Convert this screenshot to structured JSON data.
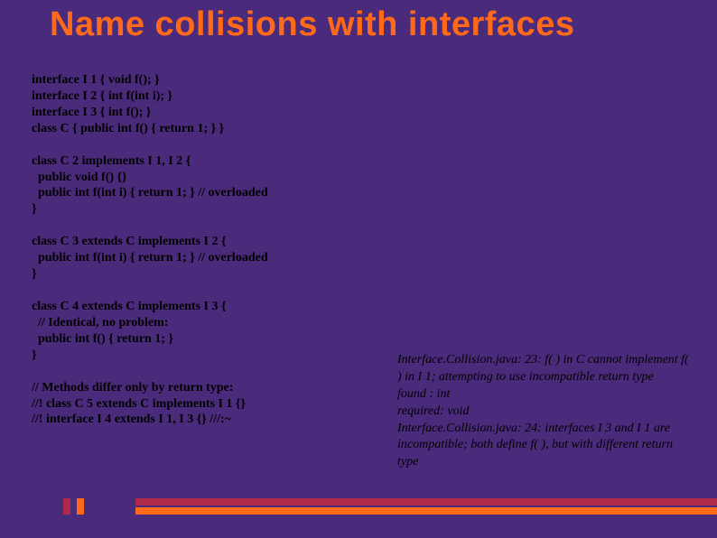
{
  "title": "Name collisions with interfaces",
  "left_blocks": [
    "interface I 1 { void f(); }\ninterface I 2 { int f(int i); }\ninterface I 3 { int f(); }\nclass C { public int f() { return 1; } }",
    "class C 2 implements I 1, I 2 {\n  public void f() {}\n  public int f(int i) { return 1; } // overloaded\n}",
    "class C 3 extends C implements I 2 {\n  public int f(int i) { return 1; } // overloaded\n}",
    "class C 4 extends C implements I 3 {\n  // Identical, no problem:\n  public int f() { return 1; }\n}",
    "// Methods differ only by return type:\n//! class C 5 extends C implements I 1 {}\n//! interface I 4 extends I 1, I 3 {} ///:~"
  ],
  "right_text": "Interface.Collision.java: 23: f( ) in C cannot implement f( ) in I 1; attempting to use incompatible return type\nfound : int\nrequired: void\nInterface.Collision.java: 24: interfaces I 3 and I 1 are incompatible; both define f( ), but with different return type"
}
